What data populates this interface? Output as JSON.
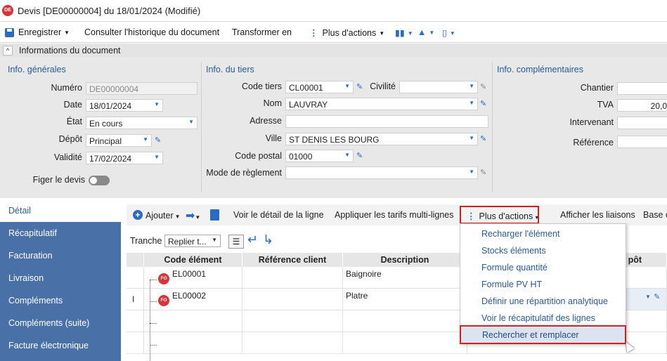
{
  "window": {
    "logo": "DE",
    "title": "Devis [DE00000004] du 18/01/2024 (Modifié)"
  },
  "toolbar": {
    "save_label": "Enregistrer",
    "history_label": "Consulter l'historique du document",
    "transform_label": "Transformer en",
    "more_actions_label": "Plus d'actions"
  },
  "info_header": {
    "label": "Informations du document"
  },
  "general": {
    "title": "Info. générales",
    "numero_label": "Numéro",
    "numero_value": "DE00000004",
    "date_label": "Date",
    "date_value": "18/01/2024",
    "etat_label": "État",
    "etat_value": "En cours",
    "depot_label": "Dépôt",
    "depot_value": "Principal",
    "validite_label": "Validité",
    "validite_value": "17/02/2024",
    "figer_label": "Figer le devis"
  },
  "tiers": {
    "title": "Info. du tiers",
    "code_label": "Code tiers",
    "code_value": "CL00001",
    "civilite_label": "Civilité",
    "civilite_value": "",
    "nom_label": "Nom",
    "nom_value": "LAUVRAY",
    "adresse_label": "Adresse",
    "adresse_value": "",
    "ville_label": "Ville",
    "ville_value": "ST DENIS LES BOURG",
    "cp_label": "Code postal",
    "cp_value": "01000",
    "reglement_label": "Mode de règlement",
    "reglement_value": ""
  },
  "complementaires": {
    "title": "Info. complémentaires",
    "chantier_label": "Chantier",
    "chantier_value": "",
    "tva_label": "TVA",
    "tva_value": "20,0",
    "intervenant_label": "Intervenant",
    "intervenant_value": "",
    "reference_label": "Référence",
    "reference_value": ""
  },
  "nav": {
    "items": [
      "Détail",
      "Récapitulatif",
      "Facturation",
      "Livraison",
      "Compléments",
      "Compléments (suite)",
      "Facture électronique"
    ]
  },
  "detail_toolbar": {
    "add_label": "Ajouter",
    "view_detail_label": "Voir le détail de la ligne",
    "apply_rates_label": "Appliquer les tarifs multi-lignes",
    "more_actions_label": "Plus d'actions",
    "show_links_label": "Afficher les liaisons",
    "base_label": "Base c",
    "tranche_label": "Tranche",
    "tranche_value": "Replier t..."
  },
  "grid": {
    "columns": [
      "Code élément",
      "Référence client",
      "Description",
      "pôt"
    ],
    "rows": [
      {
        "badge": "FO",
        "code": "EL00001",
        "ref": "",
        "description": "Baignoire"
      },
      {
        "badge": "FO",
        "code": "EL00002",
        "ref": "",
        "description": "Platre"
      }
    ]
  },
  "menu": {
    "items": [
      "Recharger l'élément",
      "Stocks éléments",
      "Formule quantité",
      "Formule PV HT",
      "Définir une répartition analytique",
      "Voir le récapitulatif des lignes",
      "Rechercher et remplacer"
    ]
  },
  "colors": {
    "accent": "#2a5a97",
    "nav_bg": "#4a70a8",
    "badge": "#d9343a",
    "highlight_border": "#d02020"
  }
}
